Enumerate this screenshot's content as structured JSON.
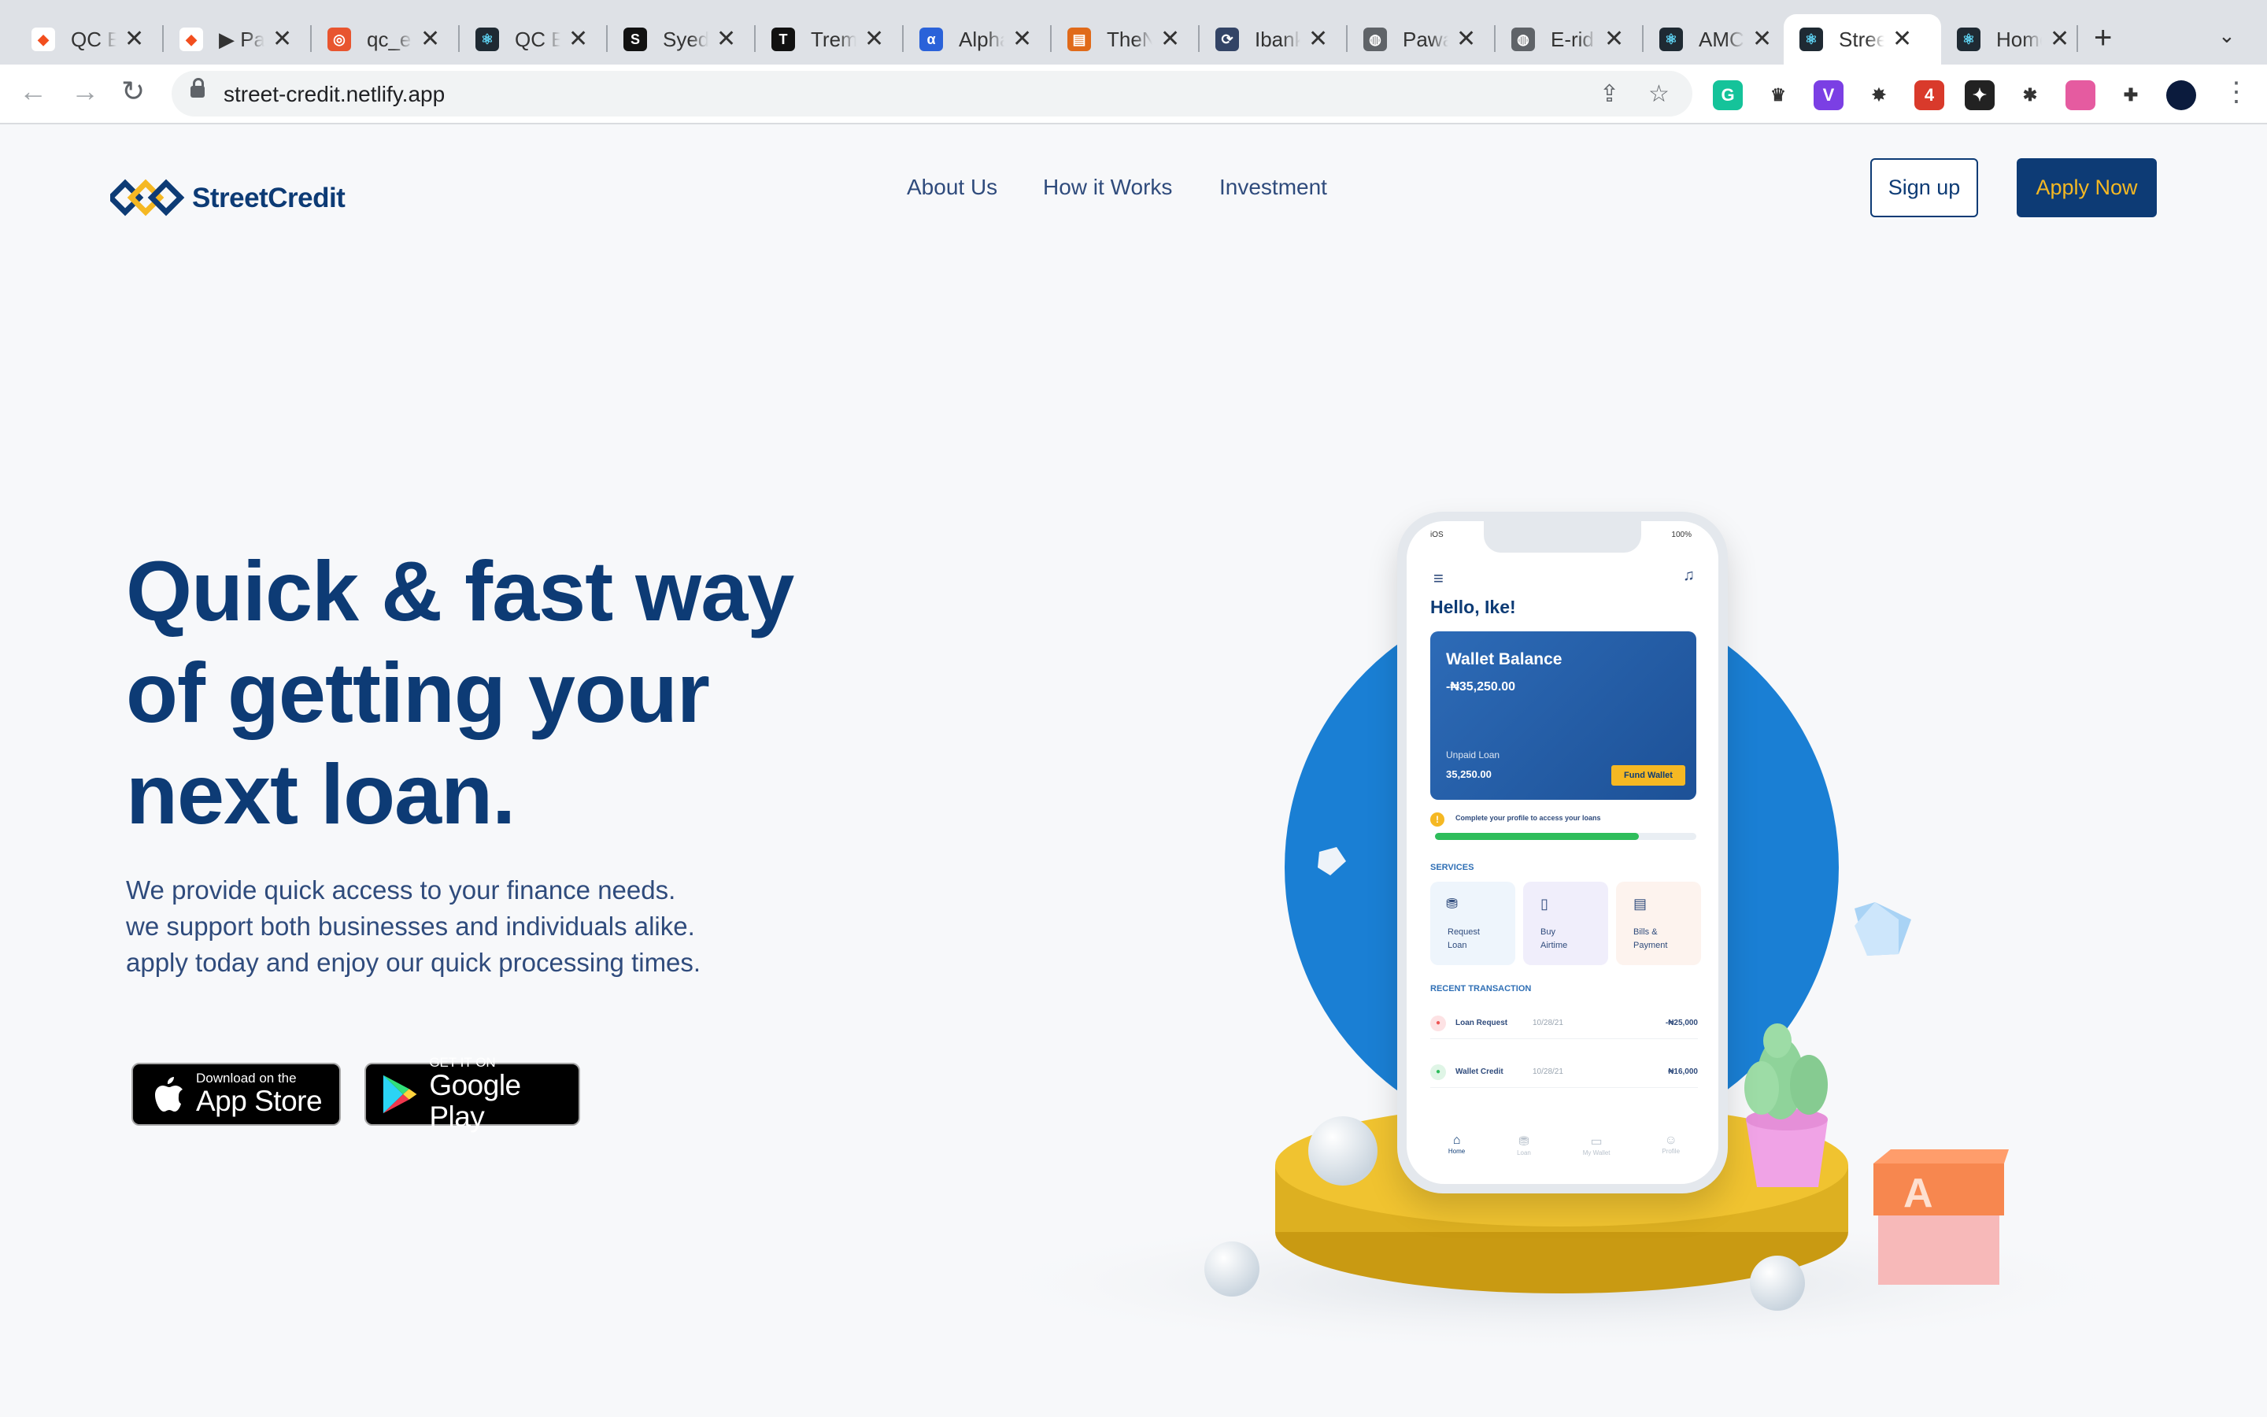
{
  "browser": {
    "tabs": [
      {
        "title": "QC E",
        "icon": "figma-icon",
        "color": "#ffffff"
      },
      {
        "title": "▶ Pa",
        "icon": "figma-icon",
        "color": "#ffffff"
      },
      {
        "title": "qc_e",
        "icon": "swirl-icon",
        "color": "#e8552f"
      },
      {
        "title": "QC E",
        "icon": "react-icon",
        "color": "#1f2a33"
      },
      {
        "title": "Syed",
        "icon": "s-icon",
        "color": "#111111"
      },
      {
        "title": "Trem",
        "icon": "t-icon",
        "color": "#111111"
      },
      {
        "title": "Alpha",
        "icon": "alpha-icon",
        "color": "#2a62d9"
      },
      {
        "title": "TheN",
        "icon": "news-icon",
        "color": "#e06a1a"
      },
      {
        "title": "Ibank",
        "icon": "bank-icon",
        "color": "#334466"
      },
      {
        "title": "Pawa",
        "icon": "globe-icon",
        "color": "#5f6368"
      },
      {
        "title": "E-rid",
        "icon": "globe-icon",
        "color": "#5f6368"
      },
      {
        "title": "AMC",
        "icon": "react-icon",
        "color": "#1f2a33"
      },
      {
        "title": "Stree",
        "icon": "react-icon",
        "color": "#1f2a33",
        "active": true
      },
      {
        "title": "Home",
        "icon": "react-icon",
        "color": "#1f2a33"
      }
    ],
    "close_glyph": "✕",
    "new_tab_glyph": "+",
    "tab_menu_glyph": "⌄",
    "back_glyph": "←",
    "forward_glyph": "→",
    "reload_glyph": "↻",
    "url": "street-credit.netlify.app",
    "share_glyph": "⇪",
    "star_glyph": "☆",
    "menu_glyph": "⋮",
    "extensions": [
      {
        "name": "grammarly-icon",
        "color": "#15c39a",
        "label": "G"
      },
      {
        "name": "tampermonkey-icon",
        "color": "#ffffff",
        "label": "♛"
      },
      {
        "name": "v-extension-icon",
        "color": "#7b3fe4",
        "label": "V"
      },
      {
        "name": "color-wheel-icon",
        "color": "#ffffff",
        "label": "✸"
      },
      {
        "name": "badge-extension-icon",
        "color": "#d93a2b",
        "label": "4"
      },
      {
        "name": "flame-extension-icon",
        "color": "#222222",
        "label": "✦"
      },
      {
        "name": "bug-extension-icon",
        "color": "#ffffff",
        "label": "✱"
      },
      {
        "name": "gradient-extension-icon",
        "color": "#e55ba0",
        "label": ""
      },
      {
        "name": "puzzle-icon",
        "color": "#ffffff",
        "label": "✚"
      },
      {
        "name": "profile-avatar-icon",
        "color": "#0b1b3d",
        "label": ""
      }
    ]
  },
  "header": {
    "logo_text": "StreetCredit",
    "nav": [
      "About Us",
      "How it Works",
      "Investment"
    ],
    "signup_label": "Sign up",
    "apply_label": "Apply Now"
  },
  "hero": {
    "title_lines": [
      "Quick & fast way",
      "of getting your",
      "next loan."
    ],
    "subtitle_lines": [
      "We provide quick access to your finance needs.",
      "we support both businesses and individuals alike.",
      "apply today and enjoy our quick processing times."
    ],
    "app_store": {
      "small": "Download on the",
      "big": "App Store"
    },
    "google_play": {
      "small": "GET IT ON",
      "big": "Google Play"
    }
  },
  "phone": {
    "status_left": "iOS",
    "status_right": "100%",
    "greeting": "Hello, Ike!",
    "wallet_title": "Wallet Balance",
    "wallet_amount": "-₦35,250.00",
    "unpaid_label": "Unpaid Loan",
    "unpaid_amount": "35,250.00",
    "fund_label": "Fund Wallet",
    "profile_notice": "Complete your profile to access your loans",
    "progress": 0.78,
    "services_label": "SERVICES",
    "services": [
      {
        "line1": "Request",
        "line2": "Loan"
      },
      {
        "line1": "Buy",
        "line2": "Airtime"
      },
      {
        "line1": "Bills &",
        "line2": "Payment"
      }
    ],
    "recent_label": "RECENT TRANSACTION",
    "transactions": [
      {
        "name": "Loan Request",
        "date": "10/28/21",
        "amount": "-₦25,000"
      },
      {
        "name": "Wallet Credit",
        "date": "10/28/21",
        "amount": "₦16,000"
      }
    ],
    "bottom_nav": [
      "Home",
      "Loan",
      "My Wallet",
      "Profile"
    ],
    "block_letter": "A",
    "colors": {
      "brand": "#0d3b75",
      "accent": "#f5b823",
      "circle": "#1a7fd4",
      "podium": "#e8b72b"
    }
  }
}
